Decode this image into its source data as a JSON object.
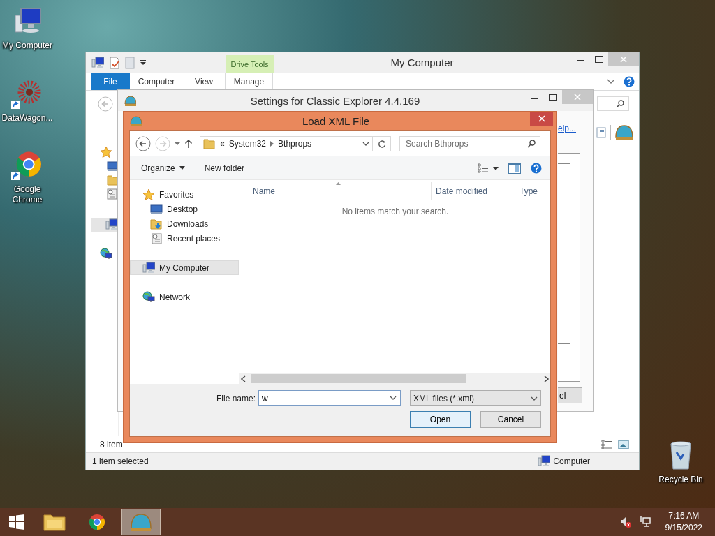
{
  "desktop_icons": [
    {
      "label": "My Computer",
      "kind": "computer"
    },
    {
      "label": "DataWagon...",
      "kind": "datawagon"
    },
    {
      "label": "Google Chrome",
      "kind": "chrome"
    },
    {
      "label": "Recycle Bin",
      "kind": "recycle"
    }
  ],
  "explorer": {
    "title": "My Computer",
    "context_group": "Drive Tools",
    "tabs": [
      {
        "label": "File",
        "kind": "file"
      },
      {
        "label": "Computer",
        "kind": "tab"
      },
      {
        "label": "View",
        "kind": "tab"
      },
      {
        "label": "Manage",
        "kind": "context"
      }
    ],
    "item_count": "8 item",
    "status": "1 item selected",
    "status_location": "Computer"
  },
  "settings": {
    "title": "Settings for Classic Explorer 4.4.169",
    "link": "elp...",
    "button": "el"
  },
  "dialog": {
    "title": "Load XML File",
    "path_overflow": "«",
    "path": [
      "System32",
      "Bthprops"
    ],
    "search_placeholder": "Search Bthprops",
    "toolbar": [
      {
        "label": "Organize",
        "kind": "menu"
      },
      {
        "label": "New folder",
        "kind": "button"
      }
    ],
    "nav": [
      {
        "label": "Favorites",
        "kind": "star",
        "selected": false,
        "children": [
          {
            "label": "Desktop",
            "kind": "desktop",
            "selected": false
          },
          {
            "label": "Downloads",
            "kind": "downloads",
            "selected": false
          },
          {
            "label": "Recent places",
            "kind": "recent",
            "selected": false
          }
        ]
      },
      {
        "label": "My Computer",
        "kind": "computer",
        "selected": true
      },
      {
        "label": "Network",
        "kind": "network",
        "selected": false
      }
    ],
    "columns": [
      "Name",
      "Date modified",
      "Type"
    ],
    "empty_message": "No items match your search.",
    "file_name_label": "File name:",
    "file_name": "w",
    "file_type": "XML files (*.xml)",
    "buttons": [
      {
        "label": "Open",
        "default": true
      },
      {
        "label": "Cancel",
        "default": false
      }
    ]
  },
  "taskbar": {
    "items": [
      {
        "kind": "explorer",
        "active": false
      },
      {
        "kind": "chrome",
        "active": false
      },
      {
        "kind": "shell",
        "active": true
      }
    ],
    "time": "7:16 AM",
    "date": "9/15/2022"
  }
}
